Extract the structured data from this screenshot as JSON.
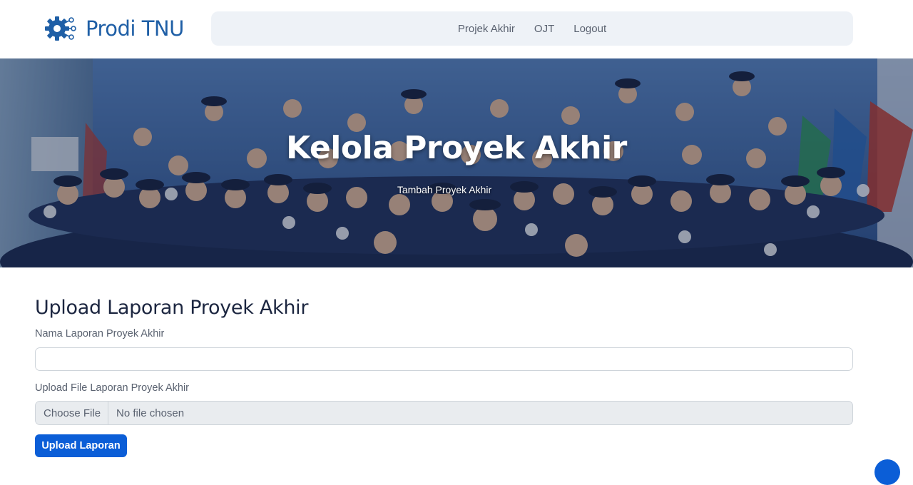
{
  "header": {
    "brand_name": "Prodi TNU",
    "brand_icon": "gear-icon",
    "nav": [
      {
        "label": "Projek Akhir"
      },
      {
        "label": "OJT"
      },
      {
        "label": "Logout"
      }
    ]
  },
  "hero": {
    "title": "Kelola Proyek Akhir",
    "subtitle": "Tambah Proyek Akhir"
  },
  "form": {
    "heading": "Upload Laporan Proyek Akhir",
    "name_label": "Nama Laporan Proyek Akhir",
    "name_value": "",
    "file_label": "Upload File Laporan Proyek Akhir",
    "file_button": "Choose File",
    "file_status": "No file chosen",
    "submit_label": "Upload Laporan"
  },
  "colors": {
    "brand": "#1f5fa6",
    "primary_button": "#0b5ed7",
    "navbar_bg": "#eef2f7"
  }
}
